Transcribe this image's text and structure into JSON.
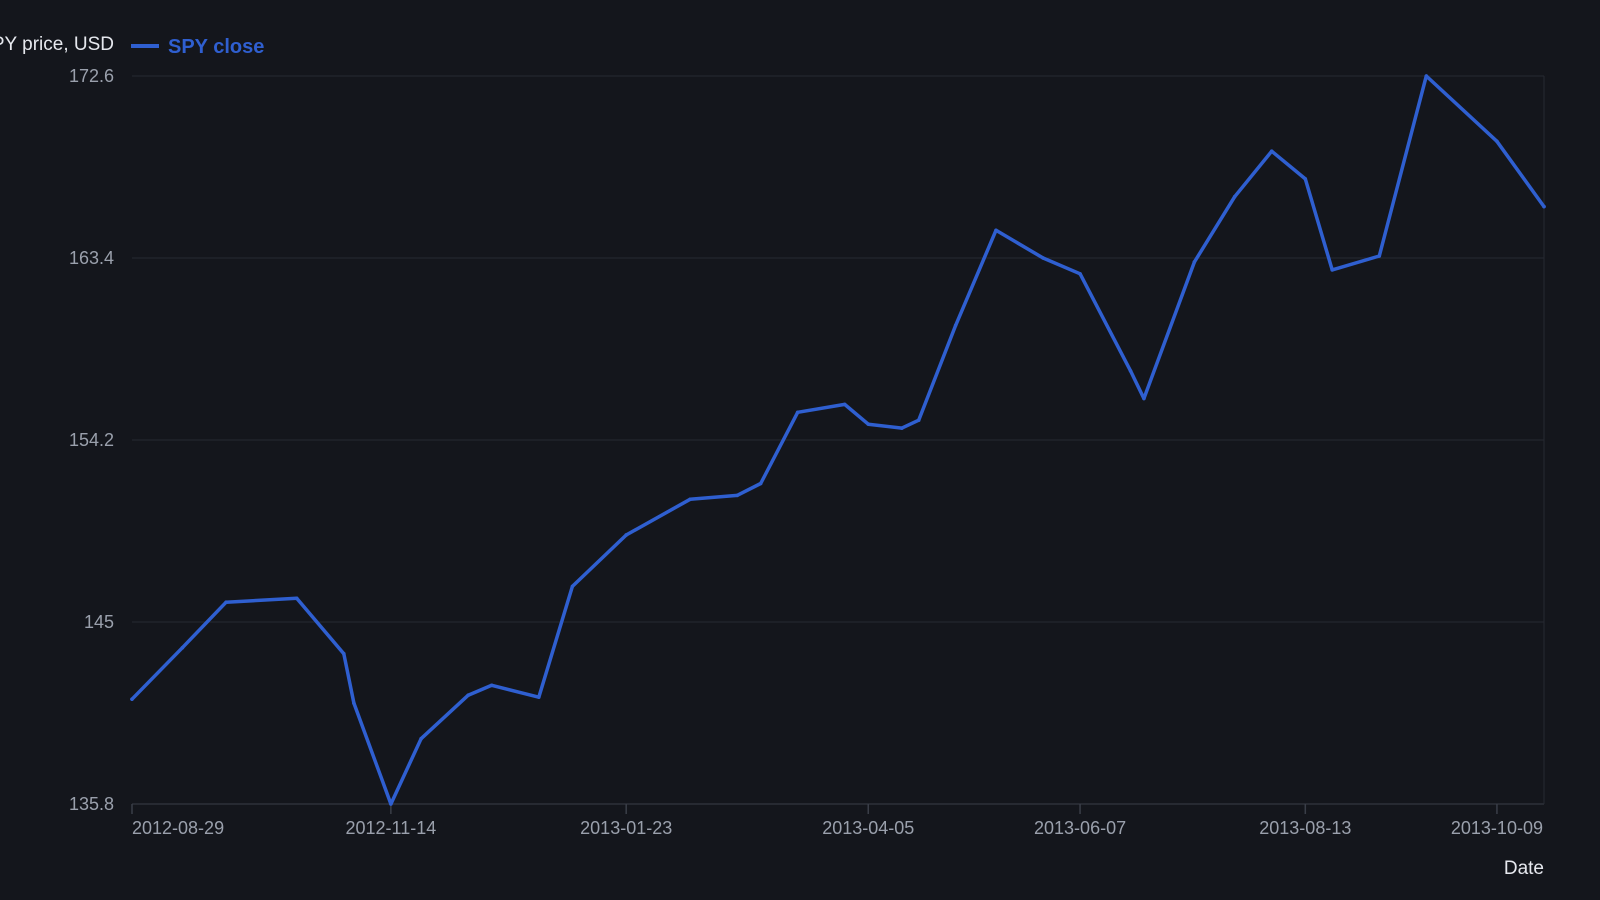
{
  "chart_data": {
    "type": "line",
    "xlabel": "Date",
    "ylabel": "PY price, USD",
    "ylim": [
      135.8,
      172.6
    ],
    "yticks": [
      "135.8",
      "145",
      "154.2",
      "163.4",
      "172.6"
    ],
    "xlim": [
      "2012-08-29",
      "2013-10-23"
    ],
    "xticks": [
      "2012-08-29",
      "2012-11-14",
      "2013-01-23",
      "2013-04-05",
      "2013-06-07",
      "2013-08-13",
      "2013-10-09"
    ],
    "grid": "horizontal",
    "legend": "top-left",
    "colors": {
      "background": "#14161c",
      "line": "#2f5fd0",
      "grid": "#262932",
      "axis": "#3a3e48"
    },
    "series": [
      {
        "name": "SPY close",
        "points": [
          [
            "2012-08-29",
            141.1
          ],
          [
            "2012-09-13",
            143.7
          ],
          [
            "2012-09-26",
            146.0
          ],
          [
            "2012-10-17",
            146.2
          ],
          [
            "2012-10-31",
            143.4
          ],
          [
            "2012-11-03",
            140.9
          ],
          [
            "2012-11-14",
            135.8
          ],
          [
            "2012-11-23",
            139.1
          ],
          [
            "2012-12-07",
            141.3
          ],
          [
            "2012-12-14",
            141.8
          ],
          [
            "2012-12-28",
            141.2
          ],
          [
            "2013-01-07",
            146.8
          ],
          [
            "2013-01-23",
            149.4
          ],
          [
            "2013-02-11",
            151.2
          ],
          [
            "2013-02-25",
            151.4
          ],
          [
            "2013-03-04",
            152.0
          ],
          [
            "2013-03-15",
            155.6
          ],
          [
            "2013-03-29",
            156.0
          ],
          [
            "2013-04-05",
            155.0
          ],
          [
            "2013-04-15",
            154.8
          ],
          [
            "2013-04-20",
            155.2
          ],
          [
            "2013-05-01",
            160.0
          ],
          [
            "2013-05-13",
            164.8
          ],
          [
            "2013-05-27",
            163.4
          ],
          [
            "2013-06-07",
            162.6
          ],
          [
            "2013-06-22",
            157.7
          ],
          [
            "2013-06-26",
            156.3
          ],
          [
            "2013-07-11",
            163.2
          ],
          [
            "2013-07-23",
            166.5
          ],
          [
            "2013-08-03",
            168.8
          ],
          [
            "2013-08-13",
            167.4
          ],
          [
            "2013-08-21",
            162.8
          ],
          [
            "2013-09-04",
            163.5
          ],
          [
            "2013-09-18",
            172.6
          ],
          [
            "2013-10-09",
            169.3
          ],
          [
            "2013-10-23",
            166.0
          ]
        ]
      }
    ]
  }
}
